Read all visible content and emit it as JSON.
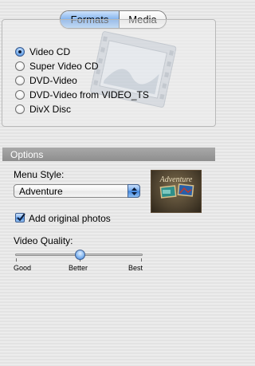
{
  "tabs": [
    {
      "label": "Formats",
      "selected": true
    },
    {
      "label": "Media",
      "selected": false
    }
  ],
  "formats": {
    "options": [
      {
        "label": "Video CD",
        "selected": true
      },
      {
        "label": "Super Video CD",
        "selected": false
      },
      {
        "label": "DVD-Video",
        "selected": false
      },
      {
        "label": "DVD-Video from VIDEO_TS",
        "selected": false
      },
      {
        "label": "DivX Disc",
        "selected": false
      }
    ]
  },
  "options": {
    "header": "Options",
    "menu_style_label": "Menu Style:",
    "menu_style_value": "Adventure",
    "preview_title": "Adventure",
    "add_photos_label": "Add original photos",
    "add_photos_checked": true,
    "video_quality_label": "Video Quality:",
    "quality_levels": [
      "Good",
      "Better",
      "Best"
    ],
    "quality_selected": "Better",
    "quality_value_fraction": 0.5
  },
  "colors": {
    "accent": "#5a98e6",
    "options_header": "#9a9a9a"
  }
}
